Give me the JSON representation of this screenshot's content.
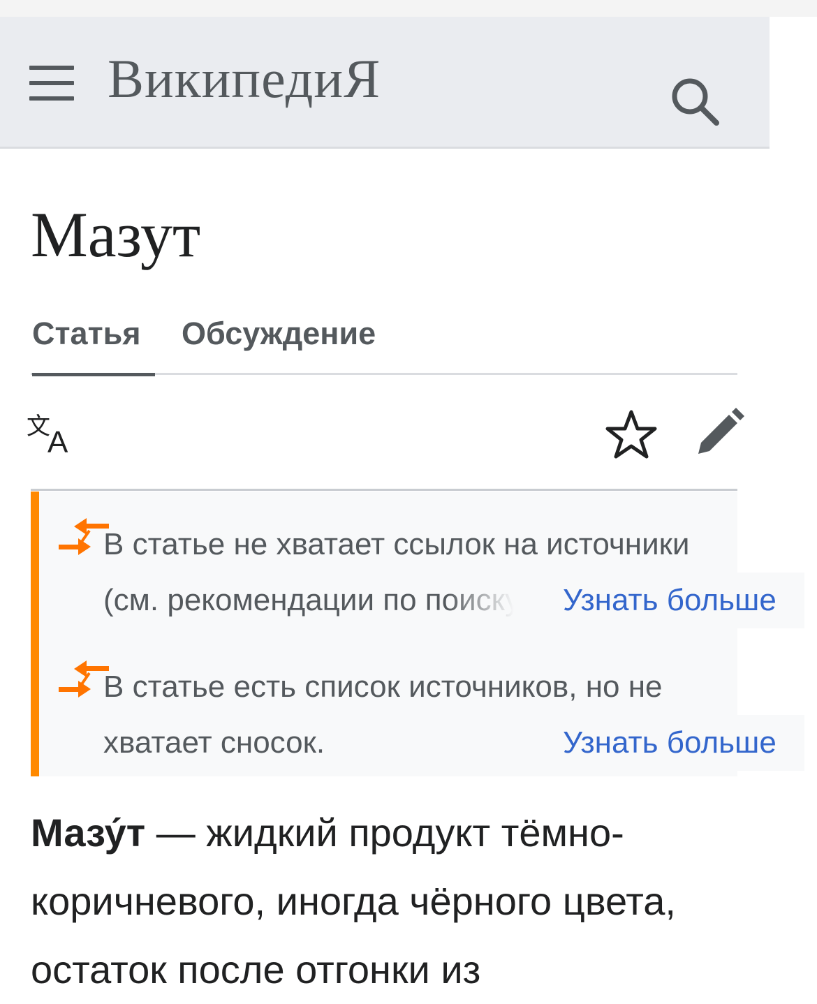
{
  "header": {
    "wordmark": "ВикипедиЯ",
    "menu_icon": "hamburger-menu-icon",
    "search_icon": "search-icon"
  },
  "page": {
    "title": "Мазут"
  },
  "tabs": [
    {
      "label": "Статья",
      "active": true
    },
    {
      "label": "Обсуждение",
      "active": false
    }
  ],
  "toolbar": {
    "language_icon": "language-icon",
    "watch_icon": "star-icon",
    "edit_icon": "pencil-icon"
  },
  "notices": [
    {
      "line1": "В статье не хватает ссылок на источники",
      "line2": "(см. рекомендации по поиску).",
      "learn_more": "Узнать больше",
      "icon": "arrows-icon"
    },
    {
      "line1": "В статье есть список источников, но не",
      "line2": "хватает сносок.",
      "learn_more": "Узнать больше",
      "icon": "arrows-icon"
    }
  ],
  "article": {
    "term": "Мазу́т",
    "lead": " — жидкий продукт тёмно-коричневого, иногда чёрного цвета, остаток после отгонки из"
  },
  "colors": {
    "header_bg": "#eaecf0",
    "notice_accent": "#ff8900",
    "link": "#3366cc",
    "text": "#202122",
    "icon_gray": "#54595d"
  }
}
